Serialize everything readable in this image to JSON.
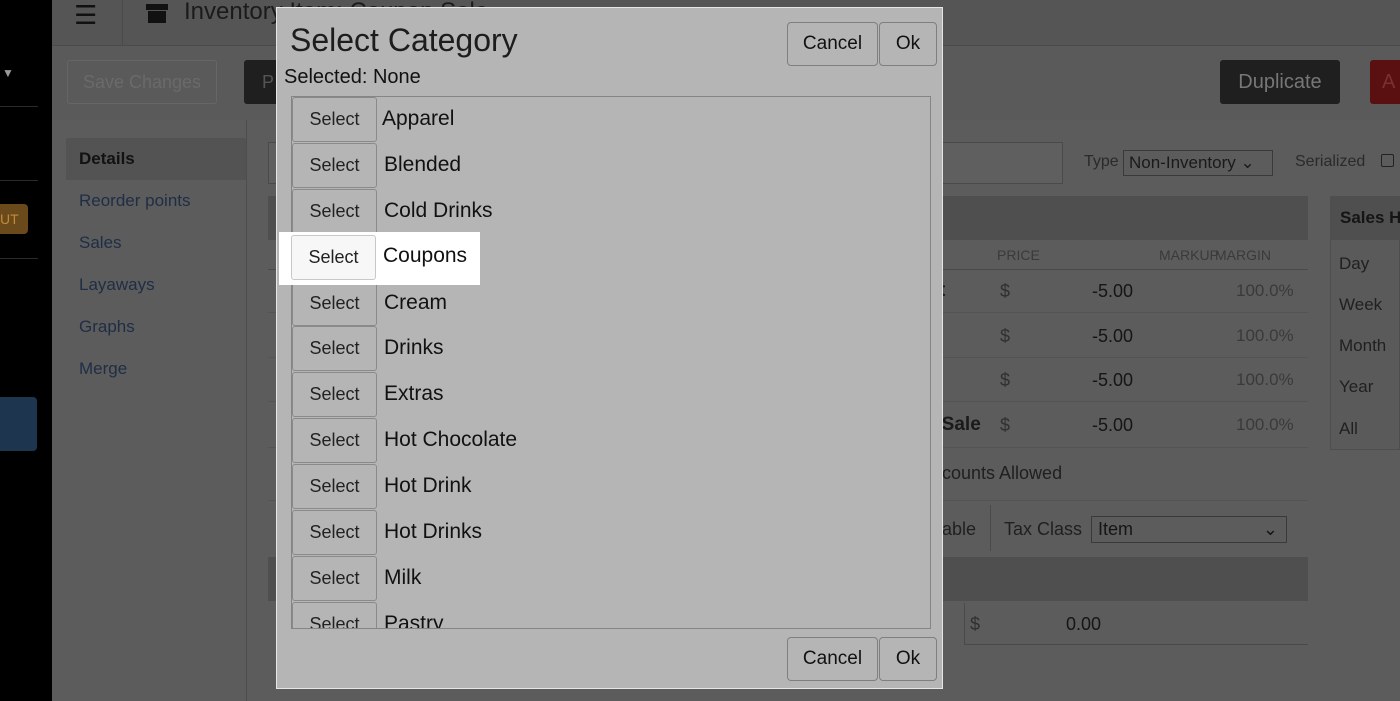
{
  "background": {
    "page_heading": "Inventory Item: Coupon Sale",
    "left_badge": "UT",
    "toolbar": {
      "save_label": "Save Changes",
      "p_label": "P",
      "duplicate_label": "Duplicate",
      "red_label": "A"
    },
    "subnav": [
      "Details",
      "Reorder points",
      "Sales",
      "Layaways",
      "Graphs",
      "Merge"
    ],
    "type_label": "Type",
    "type_value": "Non-Inventory",
    "serialized_label": "Serialized",
    "columns": {
      "price": "PRICE",
      "markup": "MARKUP",
      "margin": "MARGIN"
    },
    "price_rows": [
      {
        "frag": "t",
        "dollar": "$",
        "price": "-5.00",
        "pct": "100.0%"
      },
      {
        "frag": "",
        "dollar": "$",
        "price": "-5.00",
        "pct": "100.0%"
      },
      {
        "frag": "",
        "dollar": "$",
        "price": "-5.00",
        "pct": "100.0%"
      },
      {
        "frag": "r Sale",
        "dollar": "$",
        "price": "-5.00",
        "pct": "100.0%"
      }
    ],
    "discounts_text": "counts Allowed",
    "able_frag": "able",
    "tax_class_label": "Tax Class",
    "tax_class_value": "Item",
    "cost_dollar": "$",
    "cost_value": "0.00",
    "sales_head": "Sales H",
    "sales_items": [
      "Day",
      "Week",
      "Month",
      "Year",
      "All"
    ]
  },
  "modal": {
    "title": "Select Category",
    "selected_label": "Selected: None",
    "cancel_label": "Cancel",
    "ok_label": "Ok",
    "select_label": "Select",
    "categories": [
      "Apparel",
      "Blended",
      "Cold Drinks",
      "Coupons",
      "Cream",
      "Drinks",
      "Extras",
      "Hot Chocolate",
      "Hot Drink",
      "Hot Drinks",
      "Milk",
      "Pastry"
    ],
    "highlighted_index": 3
  }
}
